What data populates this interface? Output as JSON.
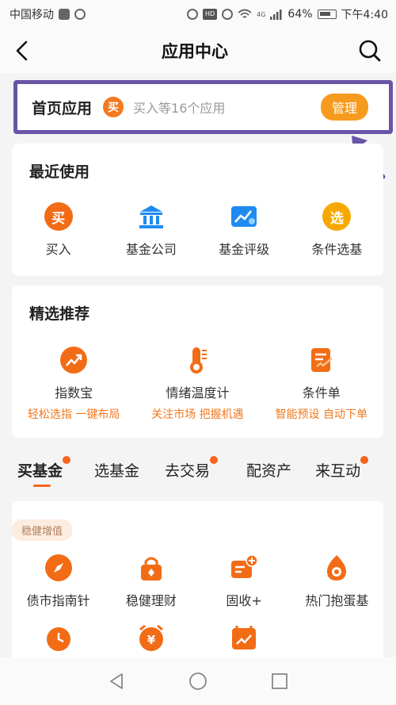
{
  "status_bar": {
    "carrier": "中国移动",
    "battery": "64%",
    "time": "下午4:40",
    "signal_label": "4G",
    "hd_label": "HD"
  },
  "nav": {
    "title": "应用中心",
    "back_icon": "back-arrow-icon",
    "search_icon": "search-icon"
  },
  "home_apps": {
    "title": "首页应用",
    "badge": "买",
    "hint": "买入等16个应用",
    "manage_label": "管理"
  },
  "recent": {
    "title": "最近使用",
    "items": [
      {
        "label": "买入",
        "icon": "buy-icon",
        "glyph": "买"
      },
      {
        "label": "基金公司",
        "icon": "bank-icon"
      },
      {
        "label": "基金评级",
        "icon": "rating-chart-icon"
      },
      {
        "label": "条件选基",
        "icon": "select-fund-icon",
        "glyph": "选"
      }
    ]
  },
  "featured": {
    "title": "精选推荐",
    "items": [
      {
        "label": "指数宝",
        "subtitle": "轻松选指 一键布局",
        "icon": "trend-up-icon"
      },
      {
        "label": "情绪温度计",
        "subtitle": "关注市场 把握机遇",
        "icon": "thermometer-icon"
      },
      {
        "label": "条件单",
        "subtitle": "智能预设 自动下单",
        "icon": "condition-order-icon"
      }
    ]
  },
  "tabs": [
    {
      "label": "买基金",
      "active": true,
      "dot": true
    },
    {
      "label": "选基金",
      "active": false,
      "dot": false
    },
    {
      "label": "去交易",
      "active": false,
      "dot": true
    },
    {
      "label": "配资产",
      "active": false,
      "dot": false
    },
    {
      "label": "来互动",
      "active": false,
      "dot": true
    }
  ],
  "section": {
    "pill": "稳健增值",
    "items": [
      {
        "label": "债市指南针",
        "icon": "compass-icon"
      },
      {
        "label": "稳健理财",
        "icon": "lock-bag-icon"
      },
      {
        "label": "固收+",
        "icon": "fixed-income-plus-icon"
      },
      {
        "label": "热门抱蛋基",
        "icon": "egg-icon"
      }
    ],
    "more_icons": [
      "alarm-clock-icon",
      "yuan-clock-icon",
      "calendar-trend-icon"
    ]
  },
  "colors": {
    "accent": "#f26c16",
    "highlight_border": "#6a54a7",
    "manage_button": "#f69b1e"
  }
}
